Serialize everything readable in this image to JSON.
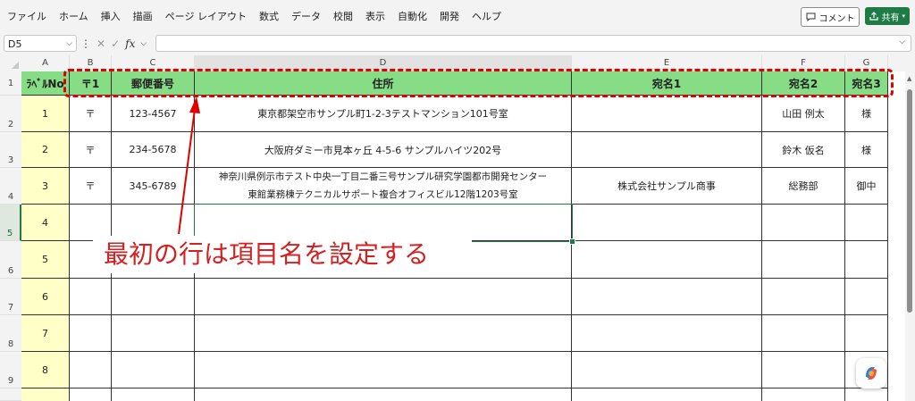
{
  "menu": [
    "ファイル",
    "ホーム",
    "挿入",
    "描画",
    "ページ レイアウト",
    "数式",
    "データ",
    "校閲",
    "表示",
    "自動化",
    "開発",
    "ヘルプ"
  ],
  "toolbar": {
    "comment_label": "コメント",
    "share_label": "共有"
  },
  "formula_bar": {
    "name_box": "D5",
    "fx": "fx",
    "formula_value": ""
  },
  "columns": [
    "A",
    "B",
    "C",
    "D",
    "E",
    "F",
    "G"
  ],
  "rows": [
    "1",
    "2",
    "3",
    "4",
    "5",
    "6",
    "7",
    "8",
    "9"
  ],
  "header": {
    "label_no": "ﾗﾍﾞﾙNo",
    "postal_mark": "〒1",
    "postal_code": "郵便番号",
    "address": "住所",
    "recipient1": "宛名1",
    "recipient2": "宛名2",
    "recipient3": "宛名3"
  },
  "records": [
    {
      "no": "1",
      "mark": "〒",
      "zip": "123-4567",
      "address_line1": "東京都架空市サンプル町1-2-3テストマンション101号室",
      "address_line2": "",
      "recipient1": "",
      "recipient2": "山田 例太",
      "recipient3": "様"
    },
    {
      "no": "2",
      "mark": "〒",
      "zip": "234-5678",
      "address_line1": "大阪府ダミー市見本ヶ丘 4-5-6 サンプルハイツ202号",
      "address_line2": "",
      "recipient1": "",
      "recipient2": "鈴木 仮名",
      "recipient3": "様"
    },
    {
      "no": "3",
      "mark": "〒",
      "zip": "345-6789",
      "address_line1": "神奈川県例示市テスト中央一丁目二番三号サンプル研究学園都市開発センター",
      "address_line2": "東館業務棟テクニカルサポート複合オフィスビル12階1203号室",
      "recipient1": "株式会社サンプル商事",
      "recipient2": "総務部",
      "recipient3": "御中"
    }
  ],
  "empty_label_nos": [
    "4",
    "5",
    "6",
    "7",
    "8"
  ],
  "annotation": "最初の行は項目名を設定する",
  "colors": {
    "header_fill": "#86dd86",
    "label_fill": "#ffffc8",
    "highlight": "#e00000",
    "accent": "#1e7b45"
  }
}
